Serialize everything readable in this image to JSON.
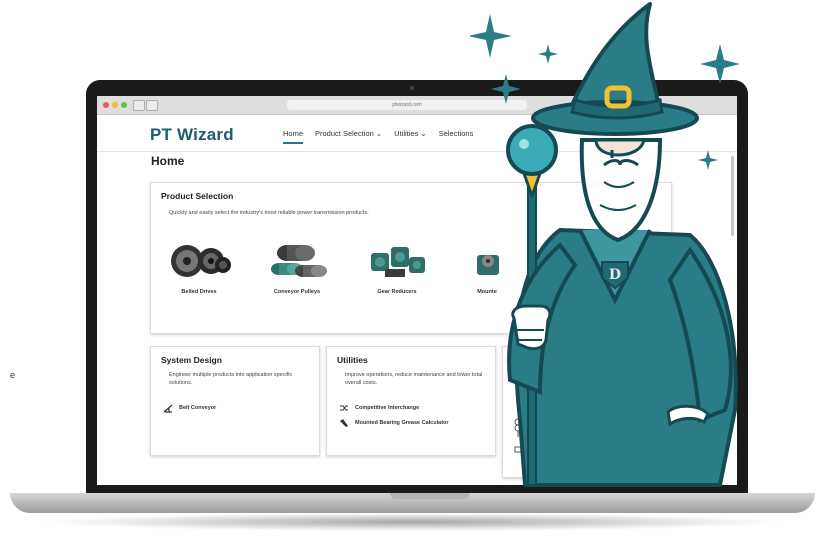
{
  "stray_text": "e",
  "browser": {
    "url": "ptwizard.com"
  },
  "header": {
    "logo": "PT Wizard",
    "nav": [
      {
        "label": "Home"
      },
      {
        "label": "Product Selection ⌄"
      },
      {
        "label": "Utilities ⌄"
      },
      {
        "label": "Selections"
      }
    ]
  },
  "page_title": "Home",
  "product_selection": {
    "title": "Product Selection",
    "description": "Quickly and easily select the industry's most reliable power transmission products.",
    "products": [
      {
        "label": "Belted Drives",
        "icon": "sheave-icon"
      },
      {
        "label": "Conveyor Pulleys",
        "icon": "pulley-icon"
      },
      {
        "label": "Gear Reducers",
        "icon": "gearbox-icon"
      },
      {
        "label": "Mounte",
        "icon": "bearing-icon"
      }
    ]
  },
  "system_design": {
    "title": "System Design",
    "description": "Engineer multiple products into application specific solutions.",
    "links": [
      {
        "label": "Belt Conveyor",
        "icon": "conveyor-icon"
      }
    ]
  },
  "utilities": {
    "title": "Utilities",
    "description": "Improve operations, reduce maintenance and lower total overall costs.",
    "links": [
      {
        "label": "Competitive Interchange",
        "icon": "shuffle-icon"
      },
      {
        "label": "Mounted Bearing Grease Calculator",
        "icon": "grease-gun-icon"
      }
    ]
  },
  "colors": {
    "brand": "#1d5e6a",
    "wizard_teal": "#2a7d86",
    "wizard_dark": "#164a52",
    "gold": "#f2c12e"
  }
}
